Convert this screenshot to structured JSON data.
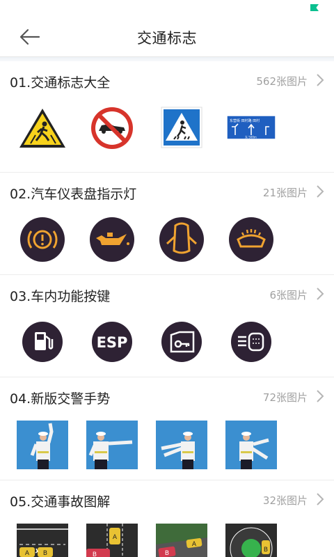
{
  "header": {
    "title": "交通标志"
  },
  "sections": [
    {
      "title": "01.交通标志大全",
      "count": "562张图片"
    },
    {
      "title": "02.汽车仪表盘指示灯",
      "count": "21张图片"
    },
    {
      "title": "03.车内功能按键",
      "count": "6张图片"
    },
    {
      "title": "04.新版交警手势",
      "count": "72张图片"
    },
    {
      "title": "05.交通事故图解",
      "count": "32张图片"
    }
  ],
  "thumbs": {
    "esp_label": "ESP",
    "road_sign_text": "东营街 田村路 田村 东 500m",
    "car_a": "A",
    "car_b": "B"
  },
  "colors": {
    "dashboard_orange": "#f0a330",
    "button_dark": "#2e2234",
    "accent_green": "#0bbf8f"
  }
}
